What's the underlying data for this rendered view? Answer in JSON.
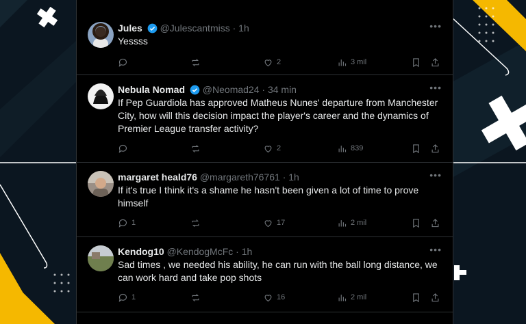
{
  "colors": {
    "background": "#0b1620",
    "accent_yellow": "#f5b800",
    "panel": "#000000",
    "verified": "#1d9bf0"
  },
  "tweets": [
    {
      "name": "Jules",
      "verified": true,
      "handle": "@Julescantmiss",
      "time": "· 1h",
      "text": "Yessss",
      "replies": "",
      "retweets": "",
      "likes": "2",
      "views": "3 mil",
      "avatar": "person-avatar"
    },
    {
      "name": "Nebula Nomad",
      "verified": true,
      "handle": "@Neomad24",
      "time": "· 34 min",
      "text": "If Pep Guardiola has approved Matheus Nunes' departure from Manchester City, how will this decision impact the player's career and the dynamics of Premier League transfer activity?",
      "replies": "",
      "retweets": "",
      "likes": "2",
      "views": "839",
      "avatar": "silhouette-avatar"
    },
    {
      "name": "margaret heald76",
      "verified": false,
      "handle": "@margareth76761",
      "time": "· 1h",
      "text": "If it's true I think it's a shame he hasn't been given a lot of time to prove himself",
      "replies": "1",
      "retweets": "",
      "likes": "17",
      "views": "2 mil",
      "avatar": "person-avatar"
    },
    {
      "name": "Kendog10",
      "verified": false,
      "handle": "@KendogMcFc",
      "time": "· 1h",
      "text": "Sad times , we needed his ability, he can run with the ball long distance, we can work hard and take pop shots",
      "replies": "1",
      "retweets": "",
      "likes": "16",
      "views": "2 mil",
      "avatar": "landscape-avatar"
    }
  ]
}
